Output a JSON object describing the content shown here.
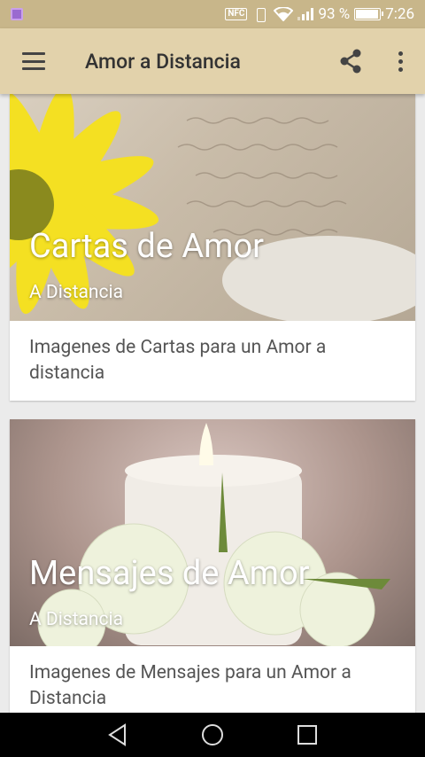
{
  "status_bar": {
    "battery_percent": "93 %",
    "time": "7:26",
    "nfc_label": "NFC",
    "icons": [
      "notification-icon",
      "nfc-icon",
      "vibrate-icon",
      "wifi-icon",
      "signal-icon",
      "battery-icon"
    ]
  },
  "app_bar": {
    "title": "Amor a Distancia",
    "icons": [
      "menu-icon",
      "share-icon",
      "more-icon"
    ]
  },
  "cards": [
    {
      "title": "Cartas de Amor",
      "subtitle": "A Distancia",
      "description": "Imagenes de Cartas para un Amor a distancia"
    },
    {
      "title": "Mensajes de Amor",
      "subtitle": "A Distancia",
      "description": "Imagenes de Mensajes para un Amor a Distancia"
    }
  ],
  "nav_bar": {
    "icons": [
      "back-icon",
      "home-icon",
      "recents-icon"
    ]
  },
  "colors": {
    "status_bar": "#c8b68a",
    "app_bar": "#e2d2ab",
    "background": "#ebebeb"
  }
}
